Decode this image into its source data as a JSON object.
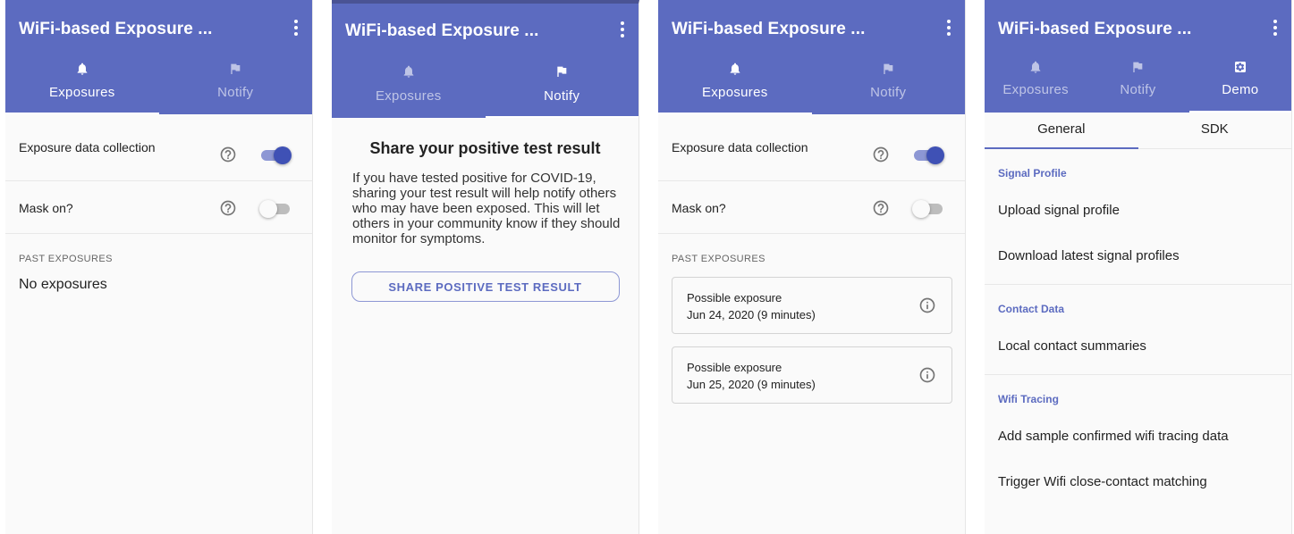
{
  "colors": {
    "primary": "#5c6bc0",
    "primary_dark": "#3f51b5",
    "switch_track_on": "#8d97d4",
    "background": "#fafafa"
  },
  "app": {
    "title": "WiFi-based Exposure ..."
  },
  "icons": {
    "tab_exposures": "bell-icon",
    "tab_notify": "flag-icon",
    "tab_demo": "gear-icon",
    "menu": "more-vert-icon",
    "help": "help-circle-icon",
    "info": "info-circle-icon"
  },
  "tabs": {
    "exposures": "Exposures",
    "notify": "Notify",
    "demo": "Demo"
  },
  "settings": {
    "collection_label": "Exposure data collection",
    "collection_on": true,
    "mask_label": "Mask on?",
    "mask_on": false
  },
  "past_exposures": {
    "caption": "PAST EXPOSURES",
    "empty_text": "No exposures",
    "items": [
      {
        "title": "Possible exposure",
        "date": "Jun 24, 2020 (9 minutes)"
      },
      {
        "title": "Possible exposure",
        "date": "Jun 25, 2020 (9 minutes)"
      }
    ]
  },
  "notify": {
    "title": "Share your positive test result",
    "body": "If you have tested positive for COVID-19, sharing your test result will help notify others who may have been exposed. This will let others in your community know if they should monitor for symptoms.",
    "button": "SHARE POSITIVE TEST RESULT"
  },
  "demo": {
    "subtabs": [
      "General",
      "SDK"
    ],
    "sections": [
      {
        "heading": "Signal Profile",
        "items": [
          "Upload signal profile",
          "Download latest signal profiles"
        ]
      },
      {
        "heading": "Contact Data",
        "items": [
          "Local contact summaries"
        ]
      },
      {
        "heading": "Wifi Tracing",
        "items": [
          "Add sample confirmed wifi tracing data",
          "Trigger Wifi close-contact matching"
        ]
      }
    ]
  }
}
